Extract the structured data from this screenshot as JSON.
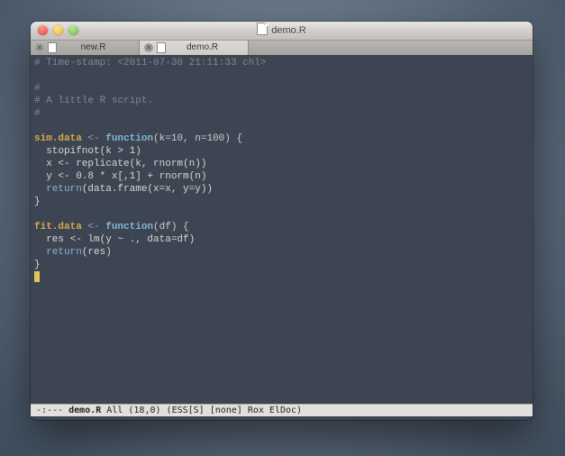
{
  "window": {
    "title": "demo.R"
  },
  "tabs": [
    {
      "label": "new.R",
      "active": false
    },
    {
      "label": "demo.R",
      "active": true
    }
  ],
  "code": {
    "l1": "# Time-stamp: <2011-07-30 21:11:33 chl>",
    "l2": "#",
    "l3": "# A little R script.",
    "l4": "#",
    "f1_name": "sim.data",
    "assign": " <- ",
    "kw_function": "function",
    "f1_sig": "(k=10, n=100) {",
    "f1_b1": "  stopifnot(k > 1)",
    "f1_b2": "  x <- replicate(k, rnorm(n))",
    "f1_b3": "  y <- 0.8 * x[,1] + rnorm(n)",
    "kw_return": "return",
    "f1_ret_arg": "(data.frame(x=x, y=y))",
    "brace_close": "}",
    "f2_name": "fit.data",
    "f2_sig": "(df) {",
    "f2_b1": "  res <- lm(y ~ ., data=df)",
    "f2_ret_arg": "(res)"
  },
  "modeline": {
    "left": "-:---",
    "buffer": "demo.R",
    "pos": "All (18,0)",
    "modes": "(ESS[S] [none] Rox ElDoc)"
  }
}
